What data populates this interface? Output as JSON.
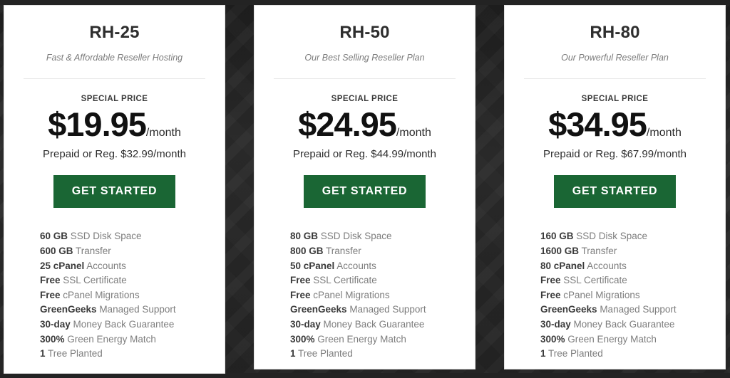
{
  "page": {
    "background_color": "#262626",
    "card_background": "#ffffff",
    "accent_color": "#1a6634"
  },
  "plans": [
    {
      "title": "RH-25",
      "subtitle": "Fast & Affordable Reseller Hosting",
      "special_label": "SPECIAL PRICE",
      "price": "$19.95",
      "period": "/month",
      "regular_price": "Prepaid or Reg. $32.99/month",
      "cta_label": "GET STARTED",
      "features": [
        {
          "strong": "60 GB",
          "rest": " SSD Disk Space"
        },
        {
          "strong": "600 GB",
          "rest": " Transfer"
        },
        {
          "strong": "25 cPanel",
          "rest": " Accounts"
        },
        {
          "strong": "Free",
          "rest": " SSL Certificate"
        },
        {
          "strong": "Free",
          "rest": " cPanel Migrations"
        },
        {
          "strong": "GreenGeeks",
          "rest": " Managed Support"
        },
        {
          "strong": "30-day",
          "rest": " Money Back Guarantee"
        },
        {
          "strong": "300%",
          "rest": " Green Energy Match"
        },
        {
          "strong": "1",
          "rest": " Tree Planted"
        }
      ]
    },
    {
      "title": "RH-50",
      "subtitle": "Our Best Selling Reseller Plan",
      "special_label": "SPECIAL PRICE",
      "price": "$24.95",
      "period": "/month",
      "regular_price": "Prepaid or Reg. $44.99/month",
      "cta_label": "GET STARTED",
      "features": [
        {
          "strong": "80 GB",
          "rest": " SSD Disk Space"
        },
        {
          "strong": "800 GB",
          "rest": " Transfer"
        },
        {
          "strong": "50 cPanel",
          "rest": " Accounts"
        },
        {
          "strong": "Free",
          "rest": " SSL Certificate"
        },
        {
          "strong": "Free",
          "rest": " cPanel Migrations"
        },
        {
          "strong": "GreenGeeks",
          "rest": " Managed Support"
        },
        {
          "strong": "30-day",
          "rest": " Money Back Guarantee"
        },
        {
          "strong": "300%",
          "rest": " Green Energy Match"
        },
        {
          "strong": "1",
          "rest": " Tree Planted"
        }
      ]
    },
    {
      "title": "RH-80",
      "subtitle": "Our Powerful Reseller Plan",
      "special_label": "SPECIAL PRICE",
      "price": "$34.95",
      "period": "/month",
      "regular_price": "Prepaid or Reg. $67.99/month",
      "cta_label": "GET STARTED",
      "features": [
        {
          "strong": "160 GB",
          "rest": " SSD Disk Space"
        },
        {
          "strong": "1600 GB",
          "rest": " Transfer"
        },
        {
          "strong": "80 cPanel",
          "rest": " Accounts"
        },
        {
          "strong": "Free",
          "rest": " SSL Certificate"
        },
        {
          "strong": "Free",
          "rest": " cPanel Migrations"
        },
        {
          "strong": "GreenGeeks",
          "rest": " Managed Support"
        },
        {
          "strong": "30-day",
          "rest": " Money Back Guarantee"
        },
        {
          "strong": "300%",
          "rest": " Green Energy Match"
        },
        {
          "strong": "1",
          "rest": " Tree Planted"
        }
      ]
    }
  ]
}
